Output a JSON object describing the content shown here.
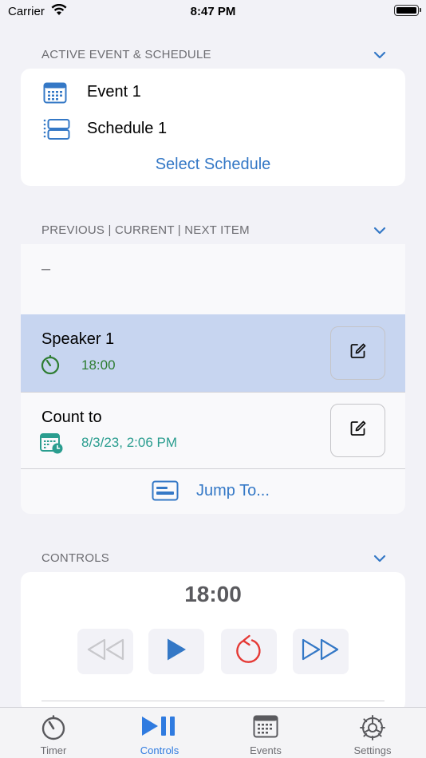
{
  "status_bar": {
    "carrier": "Carrier",
    "time": "8:47 PM"
  },
  "active_section": {
    "header": "ACTIVE EVENT & SCHEDULE",
    "event_label": "Event 1",
    "schedule_label": "Schedule 1",
    "select_schedule_label": "Select Schedule"
  },
  "items_section": {
    "header": "PREVIOUS | CURRENT | NEXT ITEM",
    "previous_placeholder": "–",
    "current": {
      "title": "Speaker 1",
      "duration": "18:00"
    },
    "next": {
      "title": "Count to",
      "datetime": "8/3/23, 2:06 PM"
    },
    "jump_label": "Jump To..."
  },
  "controls_section": {
    "header": "CONTROLS",
    "time_display": "18:00"
  },
  "tabbar": {
    "tabs": [
      {
        "label": "Timer",
        "icon": "stopwatch-icon"
      },
      {
        "label": "Controls",
        "icon": "play-pause-icon"
      },
      {
        "label": "Events",
        "icon": "calendar-icon"
      },
      {
        "label": "Settings",
        "icon": "gear-icon"
      }
    ],
    "active_tab": "Controls"
  },
  "colors": {
    "accent_blue": "#3478c6",
    "highlight_row": "#c7d5f0",
    "green": "#2e7d32",
    "teal": "#2a9d8f",
    "red": "#e53935",
    "background": "#f2f2f7"
  }
}
